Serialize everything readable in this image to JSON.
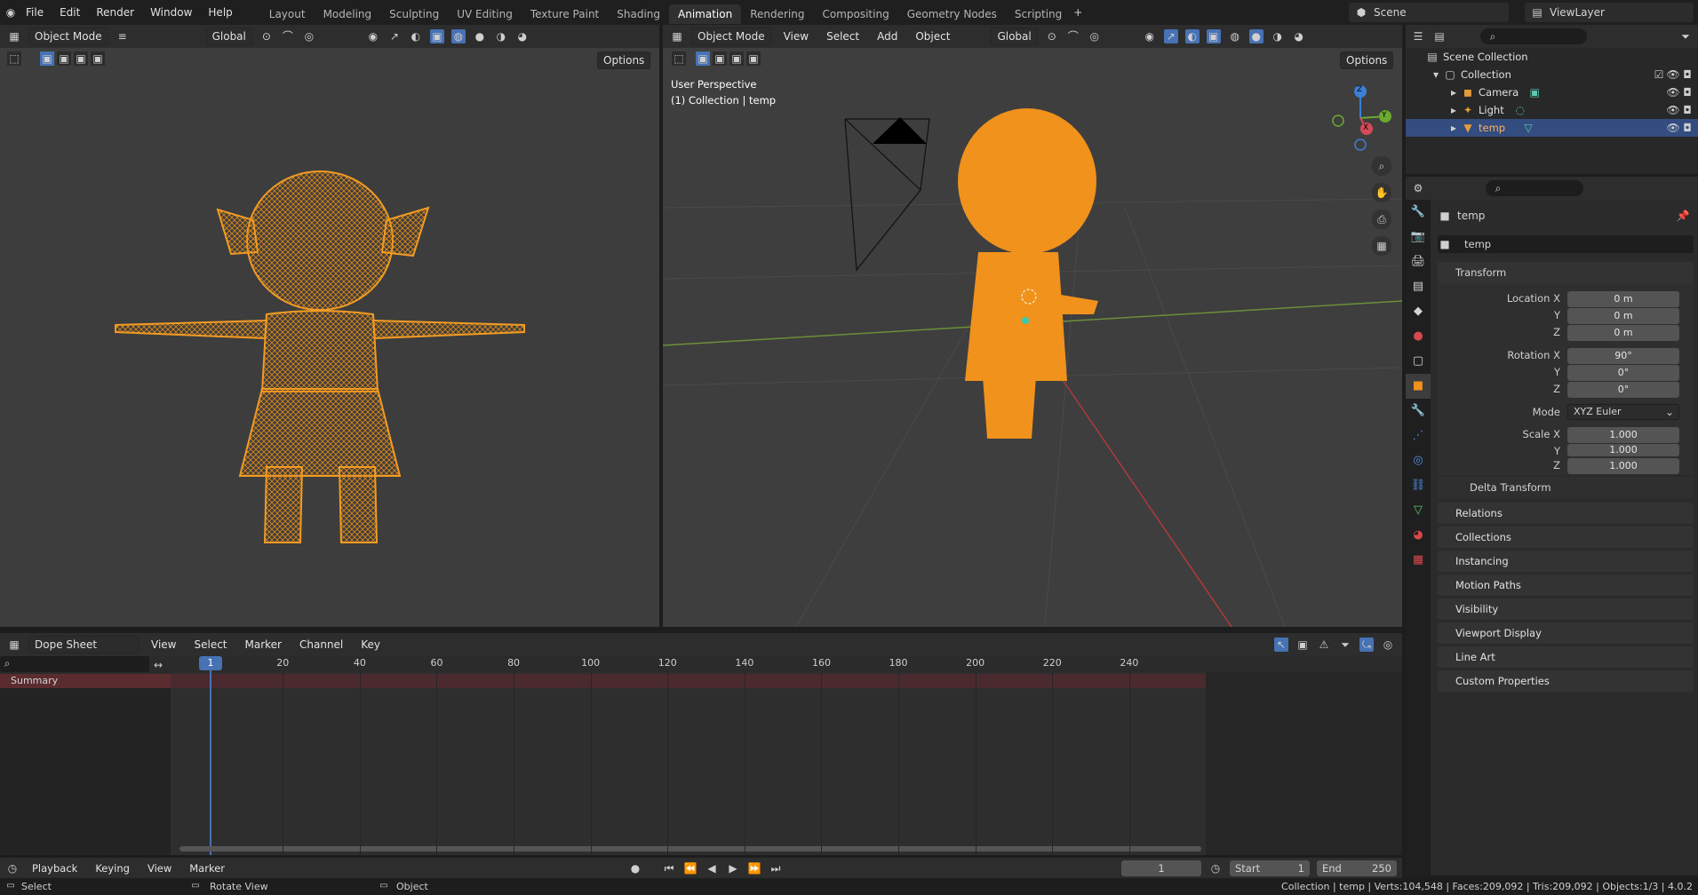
{
  "menu": {
    "file": "File",
    "edit": "Edit",
    "render": "Render",
    "window": "Window",
    "help": "Help"
  },
  "workspaces": [
    "Layout",
    "Modeling",
    "Sculpting",
    "UV Editing",
    "Texture Paint",
    "Shading",
    "Animation",
    "Rendering",
    "Compositing",
    "Geometry Nodes",
    "Scripting"
  ],
  "scene": {
    "name": "Scene",
    "view_layer": "ViewLayer"
  },
  "left_view": {
    "mode": "Object Mode",
    "orientation": "Global",
    "options": "Options"
  },
  "right_view": {
    "mode": "Object Mode",
    "menus": [
      "View",
      "Select",
      "Add",
      "Object"
    ],
    "orientation": "Global",
    "options": "Options",
    "overlay_title": "User Perspective",
    "overlay_sub": "(1) Collection | temp"
  },
  "gizmo": {
    "x": "X",
    "y": "Y",
    "z": "Z"
  },
  "outliner": {
    "root": "Scene Collection",
    "collection": "Collection",
    "items": [
      "Camera",
      "Light",
      "temp"
    ]
  },
  "properties": {
    "object_name": "temp",
    "data_name": "temp",
    "transform_label": "Transform",
    "labels": {
      "loc_x": "Location X",
      "rot_x": "Rotation X",
      "scale_x": "Scale X",
      "y": "Y",
      "z": "Z",
      "mode": "Mode"
    },
    "location": [
      "0 m",
      "0 m",
      "0 m"
    ],
    "rotation": [
      "90°",
      "0°",
      "0°"
    ],
    "mode": "XYZ Euler",
    "scale": [
      "1.000",
      "1.000",
      "1.000"
    ],
    "delta": "Delta Transform",
    "panels": [
      "Relations",
      "Collections",
      "Instancing",
      "Motion Paths",
      "Visibility",
      "Viewport Display",
      "Line Art",
      "Custom Properties"
    ]
  },
  "dope": {
    "editor": "Dope Sheet",
    "menus": [
      "View",
      "Select",
      "Marker",
      "Channel",
      "Key"
    ],
    "current_frame": "1",
    "ticks": [
      "20",
      "40",
      "60",
      "80",
      "100",
      "120",
      "140",
      "160",
      "180",
      "200",
      "220",
      "240"
    ],
    "summary": "Summary"
  },
  "timeline": {
    "playback": "Playback",
    "keying": "Keying",
    "view": "View",
    "marker": "Marker",
    "frame": "1",
    "start_label": "Start",
    "start": "1",
    "end_label": "End",
    "end": "250"
  },
  "status": {
    "select": "Select",
    "rotate": "Rotate View",
    "object": "Object",
    "info": "Collection | temp | Verts:104,548 | Faces:209,092 | Tris:209,092 | Objects:1/3 | 4.0.2"
  }
}
